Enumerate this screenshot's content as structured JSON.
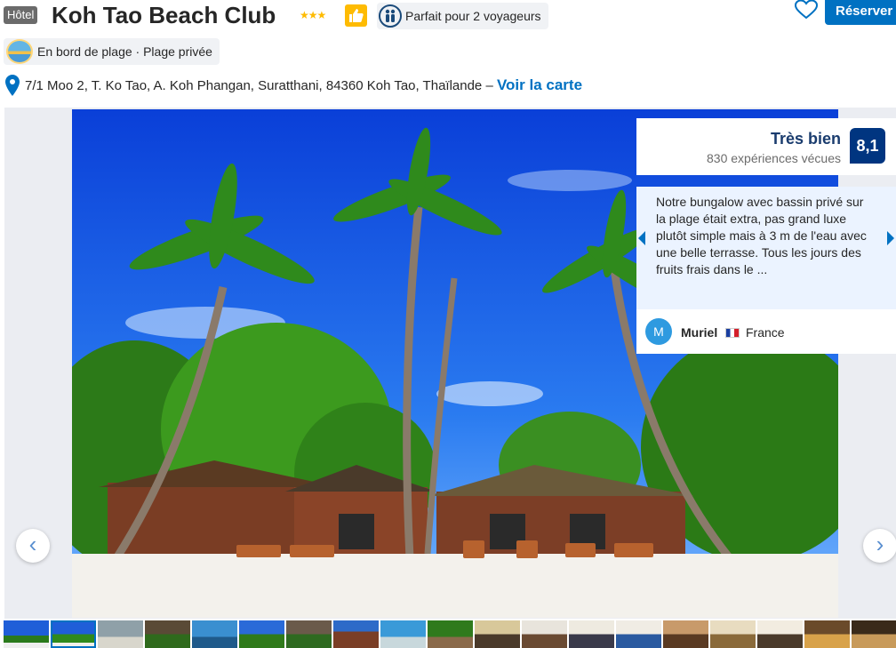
{
  "header": {
    "type_badge": "Hôtel",
    "title": "Koh Tao Beach Club",
    "stars": "★★★",
    "travelers_label": "Parfait pour 2 voyageurs",
    "reserve_label": "Réserver"
  },
  "beach": {
    "label": "En bord de plage · Plage privée"
  },
  "address": {
    "text": "7/1 Moo 2, T. Ko Tao, A. Koh Phangan, Suratthani, 84360 Koh Tao, Thaïlande – ",
    "map_link": "Voir la carte"
  },
  "rating": {
    "label": "Très bien",
    "count": "830 expériences vécues",
    "score": "8,1"
  },
  "review": {
    "text": "Notre bungalow avec bassin privé sur la plage était extra, pas grand luxe plutôt simple mais à 3 m de l'eau avec une belle terrasse. Tous les jours des fruits frais dans le ...",
    "reviewer_initial": "M",
    "reviewer_name": "Muriel",
    "reviewer_country": "France"
  },
  "gallery": {
    "prev_label": "‹",
    "next_label": "›"
  },
  "colors": {
    "brand_blue": "#0071c2",
    "score_bg": "#003580",
    "star_yellow": "#febb02"
  }
}
